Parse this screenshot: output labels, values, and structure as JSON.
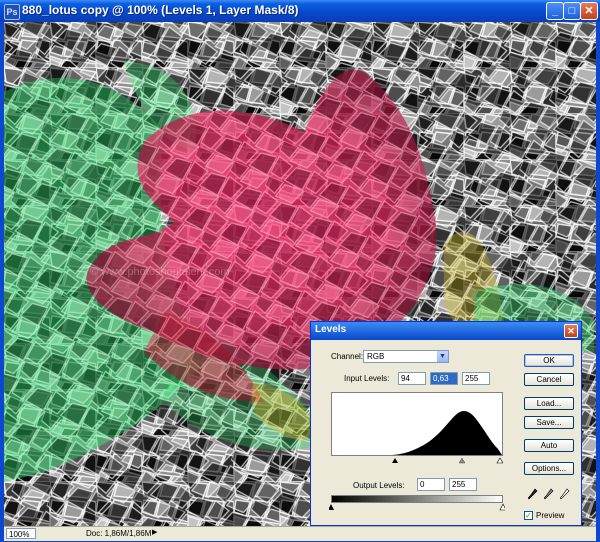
{
  "window": {
    "title": "880_lotus copy @ 100% (Levels 1, Layer Mask/8)",
    "minimize": "_",
    "maximize": "□",
    "close": "✕",
    "app_icon": "Ps"
  },
  "status": {
    "zoom": "100%",
    "doc": "Doc: 1,86M/1,86M",
    "arrow": "▶"
  },
  "levels": {
    "title": "Levels",
    "close": "✕",
    "channel_label": "Channel:",
    "channel_value": "RGB",
    "input_levels_label": "Input Levels:",
    "input_black": "94",
    "input_gamma": "0,63",
    "input_white": "255",
    "output_levels_label": "Output Levels:",
    "output_black": "0",
    "output_white": "255",
    "buttons": {
      "ok": "OK",
      "cancel": "Cancel",
      "load": "Load...",
      "save": "Save...",
      "auto": "Auto",
      "options": "Options..."
    },
    "preview_label": "Preview",
    "preview_checked": true
  },
  "colors": {
    "title_blue": "#0748c9",
    "dialog_bg": "#ece9d8",
    "lotus_pink": "#e8285f",
    "leaf_green": "#2bd76a"
  }
}
